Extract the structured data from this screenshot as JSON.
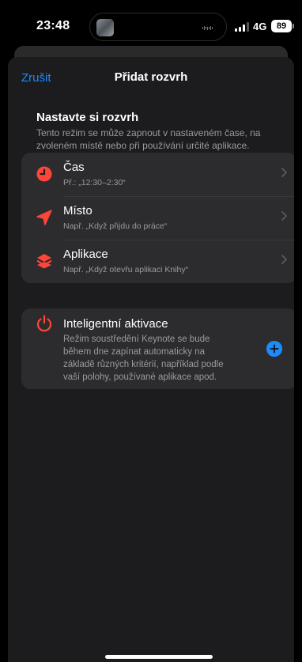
{
  "status_bar": {
    "time": "23:48",
    "network": "4G",
    "battery": "89"
  },
  "nav": {
    "cancel_label": "Zrušit",
    "title": "Přidat rozvrh"
  },
  "schedule_section": {
    "title": "Nastavte si rozvrh",
    "description": "Tento režim se může zapnout v nastaveném čase, na zvoleném místě nebo při používání určité aplikace.",
    "rows": [
      {
        "icon": "clock-icon",
        "label": "Čas",
        "sub": "Př.: „12:30–2:30“"
      },
      {
        "icon": "location-arrow-icon",
        "label": "Místo",
        "sub": "Např. „Když přijdu do práce“"
      },
      {
        "icon": "app-layers-icon",
        "label": "Aplikace",
        "sub": "Např. „Když otevřu aplikaci Knihy“"
      }
    ]
  },
  "smart_activation": {
    "icon": "power-icon",
    "title": "Inteligentní aktivace",
    "description": "Režim soustředění Keynote se bude během dne zapínat automaticky na základě různých kritérií, například podle vaší polohy, používané aplikace apod.",
    "action_icon": "add-icon"
  },
  "colors": {
    "accent_blue": "#1a8cff",
    "icon_red": "#ff453a",
    "sheet_bg": "#1c1c1e",
    "group_bg": "#2c2c2e"
  }
}
